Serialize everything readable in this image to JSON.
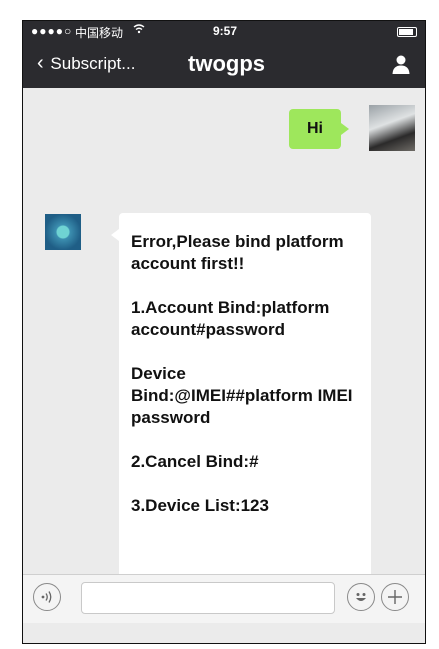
{
  "status_bar": {
    "signal": "●●●●○",
    "carrier": "中国移动",
    "time": "9:57"
  },
  "nav": {
    "back_label": "Subscript...",
    "title": "twogps"
  },
  "messages": {
    "outgoing": "Hi",
    "incoming": [
      "Error,Please bind platform account first!!",
      "1.Account Bind:platform account#password",
      "Device Bind:@IMEI##platform IMEI password",
      "2.Cancel Bind:#",
      "3.Device List:123"
    ]
  },
  "input": {
    "placeholder": ""
  },
  "icons": {
    "back": "chevron-left-icon",
    "contact": "person-icon",
    "voice": "voice-icon",
    "emoji": "emoji-icon",
    "more": "plus-icon"
  },
  "colors": {
    "nav_bg": "#2b2b2f",
    "chat_bg": "#ebebeb",
    "outgoing_bubble": "#9ee75c"
  }
}
